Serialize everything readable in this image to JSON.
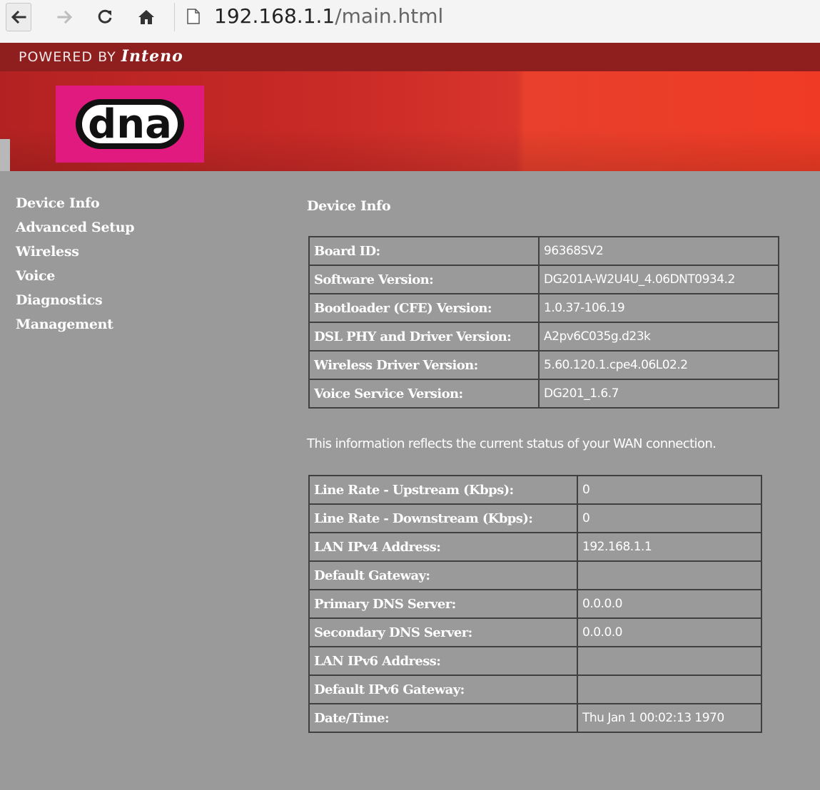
{
  "browser": {
    "back_icon": "arrow-left-icon",
    "forward_icon": "arrow-right-icon",
    "reload_icon": "reload-icon",
    "home_icon": "home-icon",
    "page_icon": "page-icon",
    "url_host": "192.168.1.1",
    "url_path": "/main.html"
  },
  "header": {
    "powered_by": "POWERED BY",
    "brand": "Inteno",
    "logo_text": "dna",
    "colors": {
      "banner_red": "#d8352c",
      "logo_pink": "#e01a7e"
    }
  },
  "sidebar": {
    "items": [
      {
        "label": "Device Info"
      },
      {
        "label": "Advanced Setup"
      },
      {
        "label": "Wireless"
      },
      {
        "label": "Voice"
      },
      {
        "label": "Diagnostics"
      },
      {
        "label": "Management"
      }
    ]
  },
  "main": {
    "title": "Device Info",
    "device_table": [
      {
        "label": "Board ID:",
        "value": "96368SV2"
      },
      {
        "label": "Software Version:",
        "value": "DG201A-W2U4U_4.06DNT0934.2"
      },
      {
        "label": "Bootloader (CFE) Version:",
        "value": "1.0.37-106.19"
      },
      {
        "label": "DSL PHY and Driver Version:",
        "value": "A2pv6C035g.d23k"
      },
      {
        "label": "Wireless Driver Version:",
        "value": "5.60.120.1.cpe4.06L02.2"
      },
      {
        "label": "Voice Service Version:",
        "value": "DG201_1.6.7"
      }
    ],
    "wan_note": "This information reflects the current status of your WAN connection.",
    "wan_table": [
      {
        "label": "Line Rate - Upstream (Kbps):",
        "value": "0"
      },
      {
        "label": "Line Rate - Downstream (Kbps):",
        "value": "0"
      },
      {
        "label": "LAN IPv4 Address:",
        "value": "192.168.1.1"
      },
      {
        "label": "Default Gateway:",
        "value": ""
      },
      {
        "label": "Primary DNS Server:",
        "value": "0.0.0.0"
      },
      {
        "label": "Secondary DNS Server:",
        "value": "0.0.0.0"
      },
      {
        "label": "LAN IPv6 Address:",
        "value": ""
      },
      {
        "label": "Default IPv6 Gateway:",
        "value": ""
      },
      {
        "label": "Date/Time:",
        "value": "Thu Jan 1 00:02:13 1970"
      }
    ]
  }
}
